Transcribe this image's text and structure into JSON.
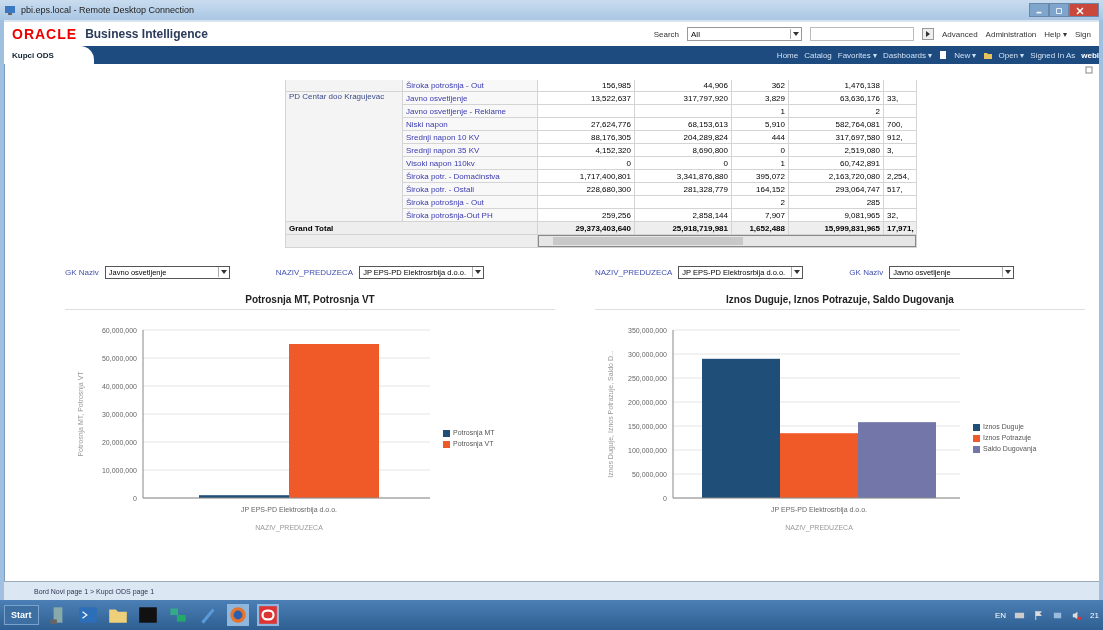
{
  "window": {
    "title": "pbi.eps.local - Remote Desktop Connection"
  },
  "header": {
    "logo": "ORACLE",
    "product": "Business Intelligence",
    "search_label": "Search",
    "search_scope": "All",
    "links": [
      "Advanced",
      "Administration",
      "Help ▾",
      "Sign"
    ]
  },
  "nav": {
    "tabs": [
      {
        "label": "Kupci ODS",
        "selected": true
      }
    ],
    "links": [
      {
        "label": "Home",
        "kind": "text"
      },
      {
        "label": "Catalog",
        "kind": "text"
      },
      {
        "label": "Favorites ▾",
        "kind": "text"
      },
      {
        "label": "Dashboards ▾",
        "kind": "text"
      },
      {
        "label": "New ▾",
        "kind": "new"
      },
      {
        "label": "Open ▾",
        "kind": "open"
      }
    ],
    "signed_in_label": "Signed In As",
    "user": "webl"
  },
  "table": {
    "groups": [
      {
        "rows": [
          {
            "item": "Široka potrošnja - Out",
            "cells": {
              "column_1": "156,985",
              "column_2": "44,906",
              "column_3": "362",
              "column_4": "1,476,138"
            }
          }
        ]
      },
      {
        "label": "PD Centar doo Kragujevac",
        "rows": [
          {
            "item": "Javno osvetljenje",
            "cells": {
              "column_1": "13,522,637",
              "column_2": "317,797,920",
              "column_3": "3,829",
              "column_4": "63,636,176",
              "column_5": "33,"
            }
          },
          {
            "item": "Javno osvetljenje - Reklame",
            "cells": {
              "column_3": "1",
              "column_4": "2"
            }
          },
          {
            "item": "Niski napon",
            "cells": {
              "column_1": "27,624,776",
              "column_2": "68,153,613",
              "column_3": "5,910",
              "column_4": "582,764,081",
              "column_5": "700,"
            }
          },
          {
            "item": "Srednji napon 10 KV",
            "cells": {
              "column_1": "88,176,305",
              "column_2": "204,289,824",
              "column_3": "444",
              "column_4": "317,697,580",
              "column_5": "912,"
            }
          },
          {
            "item": "Srednji napon 35 KV",
            "cells": {
              "column_1": "4,152,320",
              "column_2": "8,690,800",
              "column_3": "0",
              "column_4": "2,519,080",
              "column_5": "3,"
            }
          },
          {
            "item": "Visoki napon 110kv",
            "cells": {
              "column_1": "0",
              "column_2": "0",
              "column_3": "1",
              "column_4": "60,742,891"
            }
          },
          {
            "item": "Široka potr. - Domaćinstva",
            "cells": {
              "column_1": "1,717,400,801",
              "column_2": "3,341,876,880",
              "column_3": "395,072",
              "column_4": "2,163,720,080",
              "column_5": "2,254,"
            }
          },
          {
            "item": "Široka potr. - Ostali",
            "cells": {
              "column_1": "228,680,300",
              "column_2": "281,328,779",
              "column_3": "164,152",
              "column_4": "293,064,747",
              "column_5": "517,"
            }
          },
          {
            "item": "Široka potrošnja - Out",
            "cells": {
              "column_3": "2",
              "column_4": "285"
            }
          },
          {
            "item": "Široka potrošnja-Out PH",
            "cells": {
              "column_1": "259,256",
              "column_2": "2,858,144",
              "column_3": "7,907",
              "column_4": "9,081,965",
              "column_5": "32,"
            }
          }
        ]
      }
    ],
    "total": {
      "label": "Grand Total",
      "cells": {
        "column_1": "29,373,403,640",
        "column_2": "25,918,719,981",
        "column_3": "1,652,488",
        "column_4": "15,999,831,965",
        "column_5": "17,971,"
      }
    }
  },
  "filters": [
    {
      "label": "GK Naziv",
      "value": "Javno osvetljenje"
    },
    {
      "label": "NAZIV_PREDUZECA",
      "value": "JP EPS-PD Elektrosrbija d.o.o."
    },
    {
      "label": "NAZIV_PREDUZECA",
      "value": "JP EPS-PD Elektrosrbija d.o.o."
    },
    {
      "label": "GK Naziv",
      "value": "Javno osvetljenje"
    }
  ],
  "charts": [
    {
      "chart_data": {
        "type": "bar",
        "grid": true,
        "title": "Potrosnja MT, Potrosnja VT",
        "xlabel": "NAZIV_PREDUZECA",
        "ylabel": "Potrosnja MT, Potrosnja VT",
        "categories": [
          "JP EPS-PD Elektrosrbija d.o.o."
        ],
        "series": [
          {
            "name": "Potrosnja MT",
            "color": "#1f4e79",
            "values": [
              1000000
            ]
          },
          {
            "name": "Potrosnja VT",
            "color": "#f05a28",
            "values": [
              55000000
            ]
          }
        ],
        "ylim": [
          0,
          60000000
        ],
        "yticks": [
          {
            "value": 0,
            "label": "0"
          },
          {
            "value": 10000000,
            "label": "10,000,000"
          },
          {
            "value": 20000000,
            "label": "20,000,000"
          },
          {
            "value": 30000000,
            "label": "30,000,000"
          },
          {
            "value": 40000000,
            "label": "40,000,000"
          },
          {
            "value": 50000000,
            "label": "50,000,000"
          },
          {
            "value": 60000000,
            "label": "60,000,000"
          }
        ]
      }
    },
    {
      "chart_data": {
        "type": "bar",
        "grid": true,
        "title": "Iznos Duguje, Iznos Potrazuje, Saldo Dugovanja",
        "xlabel": "NAZIV_PREDUZECA",
        "ylabel": "Iznos Duguje, Iznos Potrazuje, Saldo D...",
        "categories": [
          "JP EPS-PD Elektrosrbija d.o.o."
        ],
        "series": [
          {
            "name": "Iznos Duguje",
            "color": "#1f4e79",
            "values": [
              290000000
            ]
          },
          {
            "name": "Iznos Potrazuje",
            "color": "#f05a28",
            "values": [
              135000000
            ]
          },
          {
            "name": "Saldo Dugovanja",
            "color": "#7276a8",
            "values": [
              158000000
            ]
          }
        ],
        "ylim": [
          0,
          350000000
        ],
        "yticks": [
          {
            "value": 0,
            "label": "0"
          },
          {
            "value": 50000000,
            "label": "50,000,000"
          },
          {
            "value": 100000000,
            "label": "100,000,000"
          },
          {
            "value": 150000000,
            "label": "150,000,000"
          },
          {
            "value": 200000000,
            "label": "200,000,000"
          },
          {
            "value": 250000000,
            "label": "250,000,000"
          },
          {
            "value": 300000000,
            "label": "300,000,000"
          },
          {
            "value": 350000000,
            "label": "350,000,000"
          }
        ]
      }
    }
  ],
  "breadcrumb": "Bord Novi page 1 > Kupci ODS page 1",
  "taskbar": {
    "start": "Start",
    "language": "EN",
    "clock": "21"
  }
}
